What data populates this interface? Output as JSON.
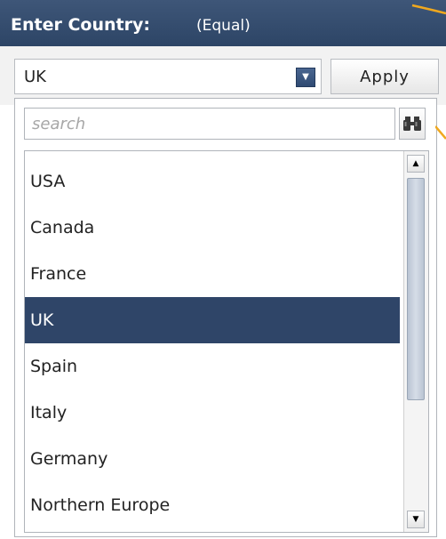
{
  "header": {
    "title": "Enter Country:",
    "subtitle": "(Equal)"
  },
  "selector": {
    "value": "UK",
    "arrow_icon": "chevron-down-icon",
    "apply_label": "Apply"
  },
  "search": {
    "placeholder": "search",
    "value": "",
    "icon": "binoculars-icon"
  },
  "list": {
    "items": [
      "USA",
      "Canada",
      "France",
      "UK",
      "Spain",
      "Italy",
      "Germany",
      "Northern Europe"
    ],
    "selected": "UK"
  },
  "colors": {
    "header_bg": "#2d4566",
    "selected_bg": "#2f4568",
    "accent": "#f0a81e"
  }
}
